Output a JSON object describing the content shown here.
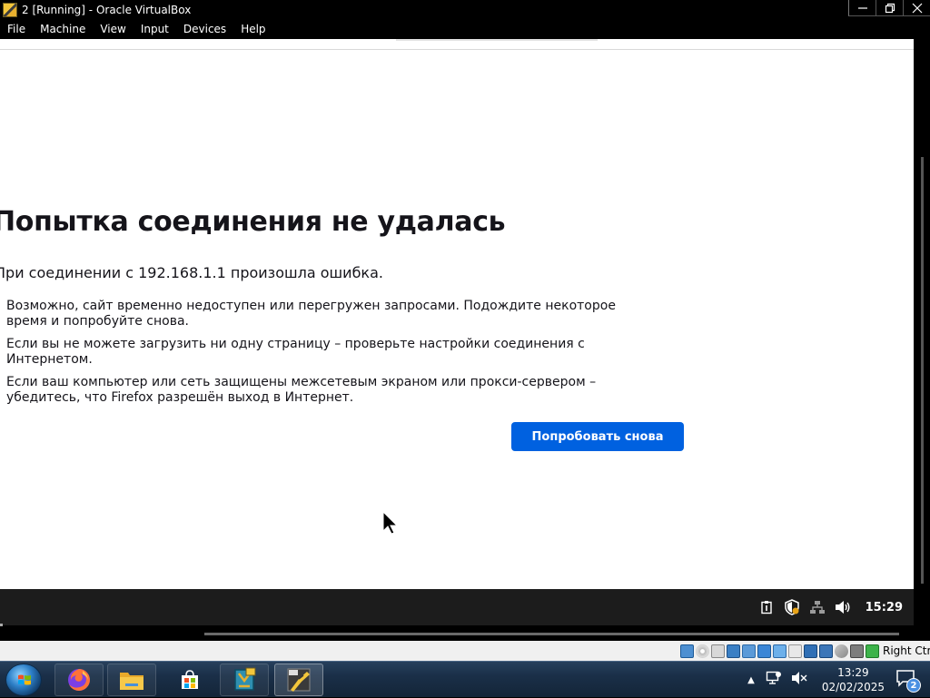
{
  "window": {
    "title": "2 [Running] - Oracle VirtualBox",
    "controls": [
      "minimize-icon",
      "restore-icon",
      "close-icon"
    ]
  },
  "menu": {
    "items": [
      "File",
      "Machine",
      "View",
      "Input",
      "Devices",
      "Help"
    ]
  },
  "error_page": {
    "title": "Попытка соединения не удалась",
    "description": "При соединении с 192.168.1.1 произошла ошибка.",
    "suggestions": [
      "Возможно, сайт временно недоступен или перегружен запросами. Подождите некоторое время и попробуйте снова.",
      "Если вы не можете загрузить ни одну страницу – проверьте настройки соединения с Интернетом.",
      "Если ваш компьютер или сеть защищены межсетевым экраном или прокси-сервером – убедитесь, что Firefox разрешён выход в Интернет."
    ],
    "retry_button": "Попробовать снова",
    "accent_color": "#0061e0"
  },
  "guest_taskbar": {
    "clock": "15:29",
    "icons": [
      "clipboard-icon",
      "shield-icon",
      "network-icon",
      "volume-icon"
    ]
  },
  "status_bar": {
    "icons": [
      "hard-disk-icon",
      "optical-drive-icon",
      "floppy-icon",
      "audio-icon",
      "network-icon",
      "usb-icon",
      "shared-folders-icon",
      "display-icon",
      "recording-icon",
      "cpu-icon",
      "mouse-integration-icon",
      "keyboard-icon"
    ],
    "host_key": "Right Ctrl"
  },
  "host_taskbar": {
    "apps": [
      "firefox-icon",
      "file-explorer-icon",
      "microsoft-store-icon",
      "virtualbox-manager-icon",
      "virtualbox-vm-icon"
    ],
    "time": "13:29",
    "date": "02/02/2025",
    "notification_count": "2"
  }
}
